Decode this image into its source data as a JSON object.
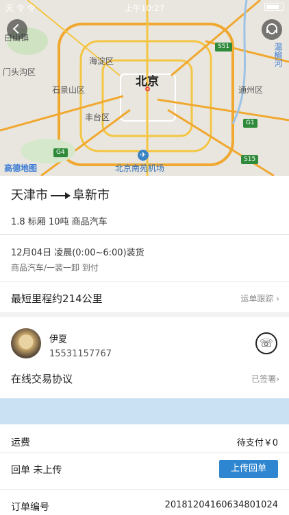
{
  "status_bar": {
    "carrier": "天 令 令",
    "time": "上午10:27"
  },
  "map": {
    "city": "北京",
    "labels": [
      "海淀区",
      "门头沟区",
      "石景山区",
      "丰台区",
      "通州区",
      "温榆河",
      "白山镇"
    ],
    "road_badges": [
      "S51",
      "G1",
      "G4",
      "S15"
    ],
    "airport": "北京南苑机场",
    "brand": "高德地图"
  },
  "route": {
    "origin": "天津市",
    "destination": "阜新市"
  },
  "cargo": "1.8 标厢 10吨 商品汽车",
  "load_time": "12月04日 凌晨(0:00~6:00)装货",
  "load_detail": "商品汽车/一装一卸 到付",
  "distance": "最短里程约214公里",
  "tracking_link": "运单跟踪",
  "contact": {
    "name": "伊夏",
    "phone": "15531157767"
  },
  "agreement": {
    "label": "在线交易协议",
    "status": "已签署"
  },
  "freight": {
    "label": "运费",
    "status": "待支付￥0"
  },
  "receipt": {
    "label": "回单 未上传",
    "button": "上传回单"
  },
  "order": {
    "label": "订单编号",
    "number": "20181204160634801024"
  }
}
